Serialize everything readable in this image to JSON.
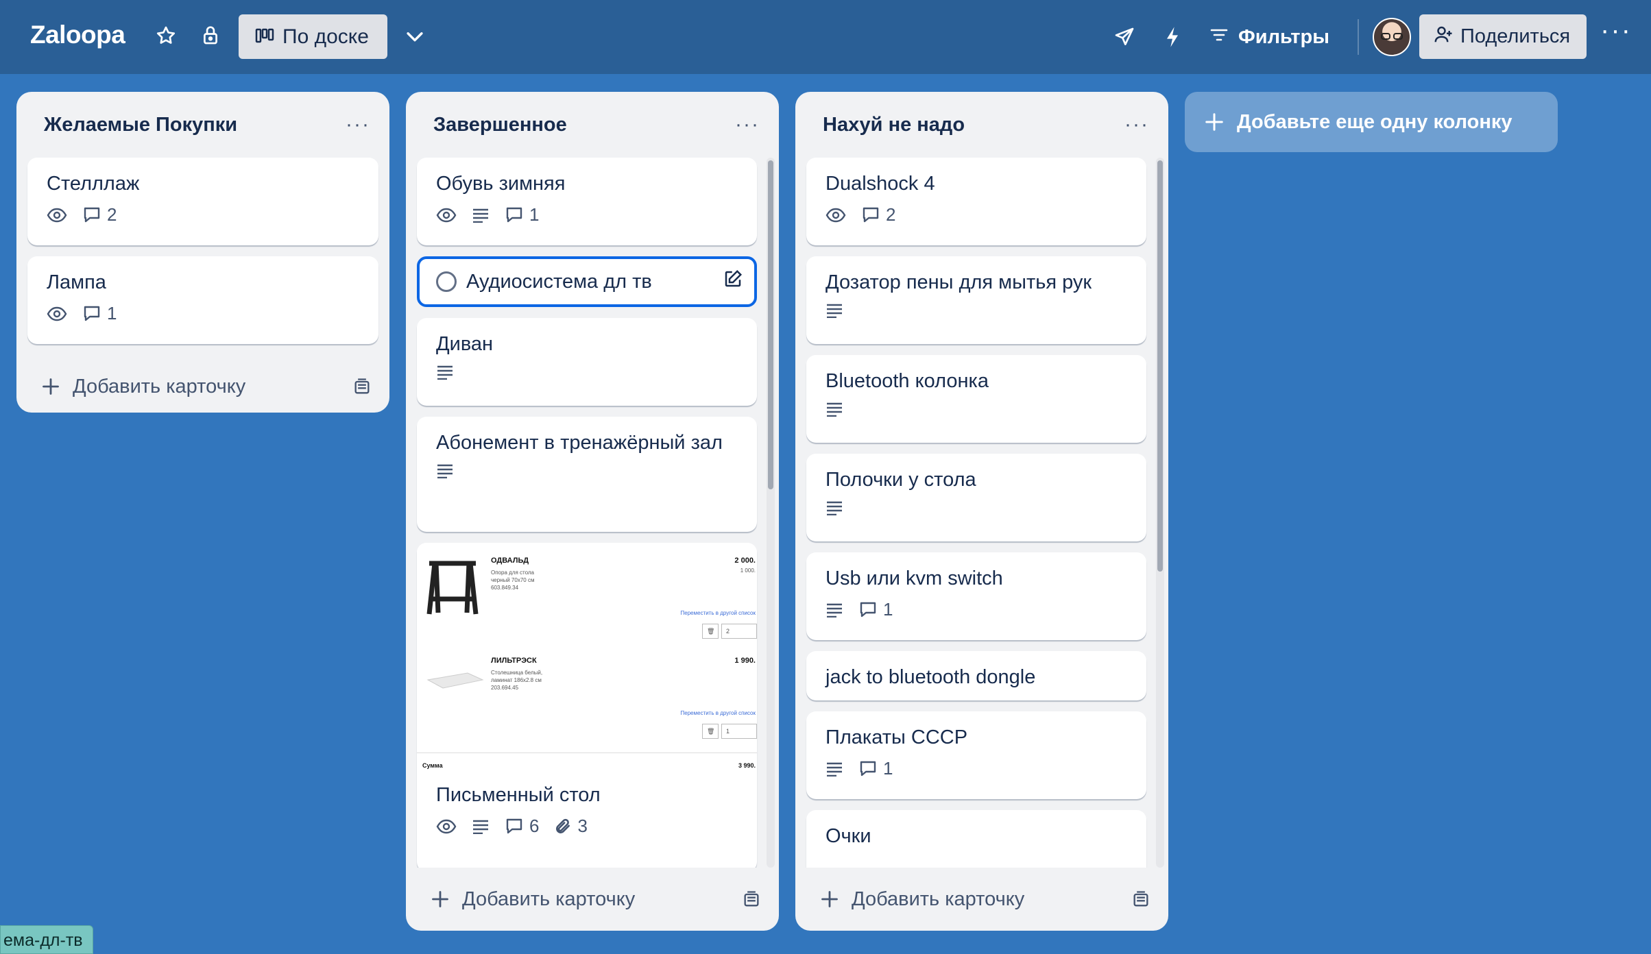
{
  "board": {
    "title": "Zaloopa",
    "view_label": "По доске",
    "filters_label": "Фильтры",
    "share_label": "Поделиться"
  },
  "columns": [
    {
      "title": "Желаемые Покупки",
      "cards": [
        {
          "title": "Стелллаж",
          "comments": "2"
        },
        {
          "title": "Лампа",
          "comments": "1"
        }
      ],
      "add_card": "Добавить карточку"
    },
    {
      "title": "Завершенное",
      "cards": [
        {
          "title": "Обувь зимняя",
          "comments": "1"
        },
        {
          "title": "Аудиосистема дл тв"
        },
        {
          "title": "Диван"
        },
        {
          "title": "Абонемент в тренажёрный зал"
        },
        {
          "title": "Письменный стол",
          "comments": "6",
          "attachments": "3"
        }
      ],
      "preview": {
        "item1_name": "ОДВАЛЬД",
        "item1_desc": "Опора для стола черный 70x70 см 603.849.34",
        "item1_price": "2 000.",
        "item1_price_small": "1 000.",
        "item1_qty": "2",
        "item2_name": "ЛИЛЬТРЭСК",
        "item2_desc": "Столешница белый, ламинат 186x2.8 см 203.694.45",
        "item2_price": "1 990.",
        "item2_qty": "1",
        "move_text": "Переместить в другой список",
        "sum_label": "Сумма",
        "sum_value": "3 990."
      },
      "add_card": "Добавить карточку"
    },
    {
      "title": "Нахуй не надо",
      "cards": [
        {
          "title": "Dualshock 4",
          "comments": "2"
        },
        {
          "title": "Дозатор пены для мытья рук"
        },
        {
          "title": "Bluetooth колонка"
        },
        {
          "title": "Полочки у стола"
        },
        {
          "title": "Usb или kvm switch",
          "comments": "1"
        },
        {
          "title": "jack to bluetooth dongle"
        },
        {
          "title": "Плакаты СССР",
          "comments": "1"
        },
        {
          "title": "Очки"
        }
      ],
      "add_card": "Добавить карточку"
    }
  ],
  "add_column_label": "Добавьте еще одну колонку",
  "status_url": "ема-дл-тв",
  "colors": {
    "topbar": "#2a5f96",
    "board_bg": "#3276bd",
    "list_bg": "#f1f2f4",
    "focus": "#0c66e4"
  }
}
